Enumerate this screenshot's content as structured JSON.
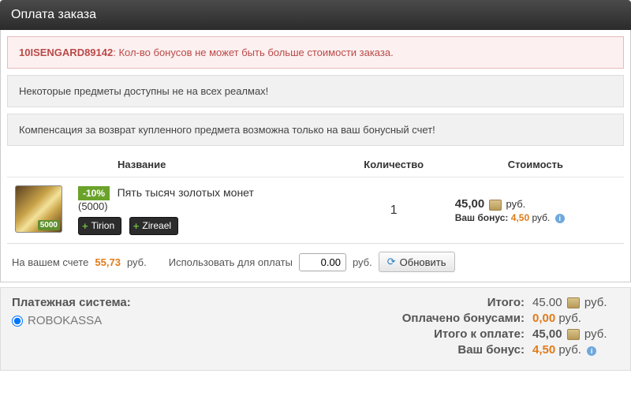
{
  "header": {
    "title": "Оплата заказа"
  },
  "error": {
    "code": "10ISENGARD89142",
    "message": ": Кол-во бонусов не может быть больше стоимости заказа."
  },
  "notices": [
    "Некоторые предметы доступны не на всех реалмах!",
    "Компенсация за возврат купленного предмета возможна только на ваш бонусный счет!"
  ],
  "table": {
    "col_name": "Название",
    "col_qty": "Количество",
    "col_cost": "Стоимость"
  },
  "item": {
    "icon_corner": "5000",
    "discount": "-10%",
    "title": "Пять тысяч золотых монет",
    "subtitle": "(5000)",
    "realms": [
      "Tirion",
      "Zireael"
    ],
    "qty": "1",
    "price": "45,00",
    "price_unit": "руб.",
    "bonus_label": "Ваш бонус:",
    "bonus_value": "4,50",
    "bonus_unit": "руб."
  },
  "usebar": {
    "balance_label": "На вашем счете",
    "balance_value": "55,73",
    "balance_unit": "руб.",
    "use_label": "Использовать для оплаты",
    "input_value": "0.00",
    "input_unit": "руб.",
    "refresh": "Обновить"
  },
  "summary": {
    "payment_system_label": "Платежная система:",
    "payment_system": "ROBOKASSA",
    "rows": {
      "total_label": "Итого:",
      "total_value": "45.00",
      "paid_bonus_label": "Оплачено бонусами:",
      "paid_bonus_value": "0,00",
      "to_pay_label": "Итого к оплате:",
      "to_pay_value": "45,00",
      "your_bonus_label": "Ваш бонус:",
      "your_bonus_value": "4,50",
      "unit": "руб."
    }
  }
}
